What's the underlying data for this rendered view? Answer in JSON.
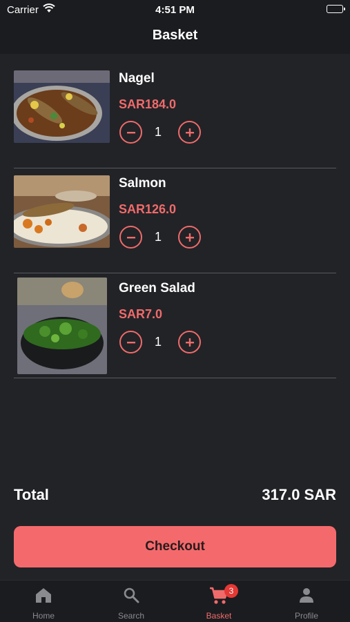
{
  "status_bar": {
    "carrier": "Carrier",
    "time": "4:51 PM"
  },
  "header": {
    "title": "Basket"
  },
  "basket": {
    "items": [
      {
        "name": "Nagel",
        "price": "SAR184.0",
        "quantity": "1",
        "image": "grilled-fish-platter"
      },
      {
        "name": "Salmon",
        "price": "SAR126.0",
        "quantity": "1",
        "image": "salmon-rice-plate"
      },
      {
        "name": "Green Salad",
        "price": "SAR7.0",
        "quantity": "1",
        "image": "green-salad-bowl"
      }
    ]
  },
  "summary": {
    "total_label": "Total",
    "total_value": "317.0 SAR"
  },
  "checkout": {
    "label": "Checkout"
  },
  "tabbar": {
    "tabs": [
      {
        "label": "Home",
        "icon": "home-icon"
      },
      {
        "label": "Search",
        "icon": "search-icon"
      },
      {
        "label": "Basket",
        "icon": "cart-icon",
        "badge": "3",
        "active": true
      },
      {
        "label": "Profile",
        "icon": "person-icon"
      }
    ]
  },
  "colors": {
    "accent": "#f06b6b",
    "button": "#f46a6c",
    "background": "#222327",
    "bar": "#1b1c1f"
  }
}
